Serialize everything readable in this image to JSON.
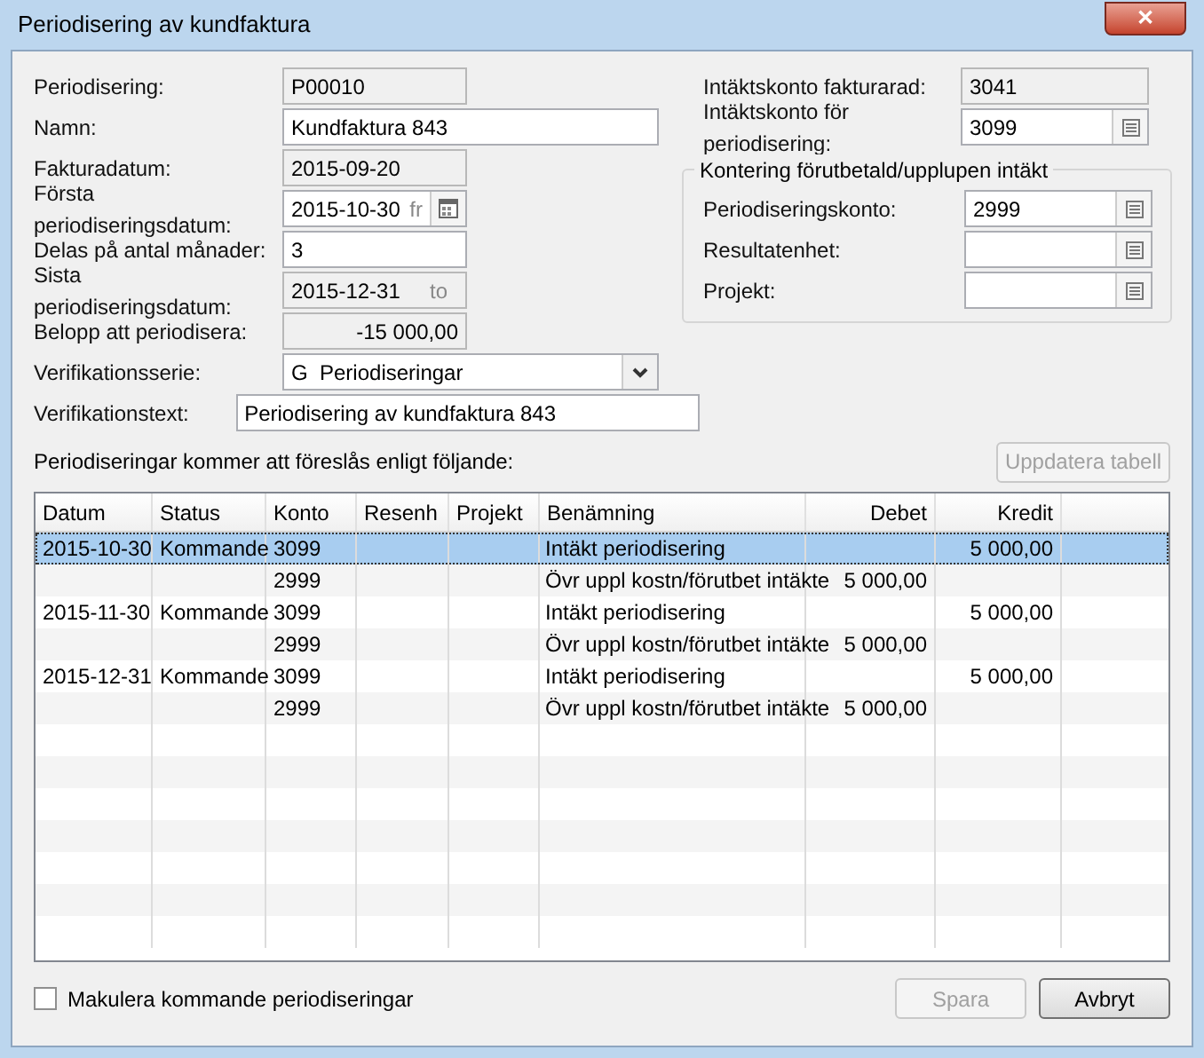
{
  "window": {
    "title": "Periodisering av kundfaktura",
    "close": "✕"
  },
  "left_fields": [
    {
      "label": "Periodisering:",
      "kind": "readonly",
      "value": "P00010"
    },
    {
      "label": "Namn:",
      "kind": "wide",
      "value": "Kundfaktura 843"
    },
    {
      "label": "Fakturadatum:",
      "kind": "readonly",
      "value": "2015-09-20"
    },
    {
      "label": "Första periodiseringsdatum:",
      "kind": "date",
      "value": "2015-10-30",
      "suffix": "fr"
    },
    {
      "label": "Delas på antal månader:",
      "kind": "input",
      "value": "3"
    },
    {
      "label": "Sista periodiseringsdatum:",
      "kind": "readonly_suffix",
      "value": "2015-12-31",
      "suffix": "to"
    },
    {
      "label": "Belopp att periodisera:",
      "kind": "amount",
      "value": "-15 000,00"
    },
    {
      "label": "Verifikationsserie:",
      "kind": "combo",
      "value": "G  Periodiseringar"
    },
    {
      "label": "Verifikationstext:",
      "kind": "long",
      "value": "Periodisering av kundfaktura 843"
    }
  ],
  "right_fields": [
    {
      "label": "Intäktskonto fakturarad:",
      "kind": "readonly",
      "value": "3041"
    },
    {
      "label": "Intäktskonto för periodisering:",
      "kind": "lookup",
      "value": "3099"
    }
  ],
  "group": {
    "title": "Kontering förutbetald/upplupen intäkt",
    "fields": [
      {
        "label": "Periodiseringskonto:",
        "kind": "lookup",
        "value": "2999"
      },
      {
        "label": "Resultatenhet:",
        "kind": "lookup"
      },
      {
        "label": "Projekt:",
        "kind": "lookup"
      }
    ]
  },
  "table_caption": "Periodiseringar kommer att föreslås enligt följande:",
  "update_button": {
    "label": "Uppdatera tabell",
    "disabled": true
  },
  "table": {
    "columns": [
      "Datum",
      "Status",
      "Konto",
      "Resenh",
      "Projekt",
      "Benämning",
      "Debet",
      "Kredit"
    ],
    "rows": [
      {
        "selected": true,
        "cells": [
          "2015-10-30",
          "Kommande",
          "3099",
          "",
          "",
          "Intäkt periodisering",
          "",
          "5 000,00"
        ]
      },
      {
        "selected": false,
        "cells": [
          "",
          "",
          "2999",
          "",
          "",
          "Övr uppl kostn/förutbet intäkte",
          "5 000,00",
          ""
        ]
      },
      {
        "selected": false,
        "cells": [
          "2015-11-30",
          "Kommande",
          "3099",
          "",
          "",
          "Intäkt periodisering",
          "",
          "5 000,00"
        ]
      },
      {
        "selected": false,
        "cells": [
          "",
          "",
          "2999",
          "",
          "",
          "Övr uppl kostn/förutbet intäkte",
          "5 000,00",
          ""
        ]
      },
      {
        "selected": false,
        "cells": [
          "2015-12-31",
          "Kommande",
          "3099",
          "",
          "",
          "Intäkt periodisering",
          "",
          "5 000,00"
        ]
      },
      {
        "selected": false,
        "cells": [
          "",
          "",
          "2999",
          "",
          "",
          "Övr uppl kostn/förutbet intäkte",
          "5 000,00",
          ""
        ]
      }
    ]
  },
  "void_checkbox": {
    "label": "Makulera kommande periodiseringar",
    "checked": false
  },
  "buttons": [
    {
      "label": "Spara",
      "disabled": true
    },
    {
      "label": "Avbryt",
      "disabled": false
    }
  ]
}
